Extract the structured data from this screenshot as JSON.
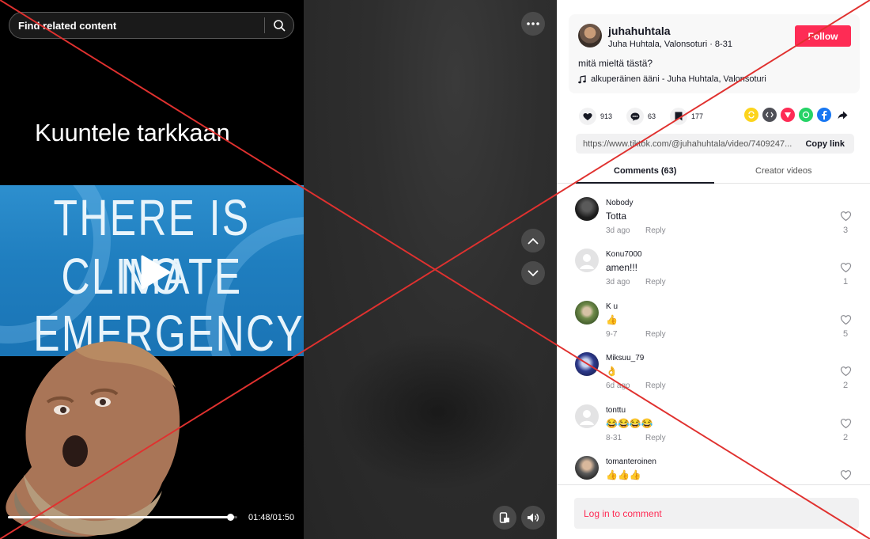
{
  "search": {
    "placeholder": "Find related content"
  },
  "video": {
    "caption": "Kuuntele tarkkaan",
    "banner_lines": [
      "THERE IS NO",
      "CLIMATE",
      "EMERGENCY"
    ],
    "time": "01:48/01:50",
    "progress_fraction": 0.97
  },
  "post": {
    "handle": "juhahuhtala",
    "author_line": "Juha Huhtala, Valonsoturi · 8-31",
    "follow_label": "Follow",
    "description": "mitä mieltä tästä?",
    "music": "alkuperäinen ääni - Juha Huhtala, Valonsoturi",
    "likes": "913",
    "comments_count": "63",
    "saves": "177",
    "link": "https://www.tiktok.com/@juhahuhtala/video/7409247...",
    "copy_label": "Copy link"
  },
  "tabs": {
    "comments": "Comments (63)",
    "creator": "Creator videos"
  },
  "comments": [
    {
      "name": "Nobody",
      "text": "Totta",
      "date": "3d ago",
      "likes": "3"
    },
    {
      "name": "Konu7000",
      "text": "amen!!!",
      "date": "3d ago",
      "likes": "1"
    },
    {
      "name": "K u",
      "text": "👍",
      "date": "9-7",
      "likes": "5"
    },
    {
      "name": "Miksuu_79",
      "text": "👌",
      "date": "6d ago",
      "likes": "2"
    },
    {
      "name": "tonttu",
      "text": "😂😂😂😂",
      "date": "8-31",
      "likes": "2"
    },
    {
      "name": "tomanteroinen",
      "text": "👍👍👍",
      "date": "",
      "likes": ""
    }
  ],
  "reply_label": "Reply",
  "login_label": "Log in to comment",
  "colors": {
    "accent": "#fe2c55",
    "banner": "#1f7ebf",
    "overlay_x": "#e0312f"
  }
}
